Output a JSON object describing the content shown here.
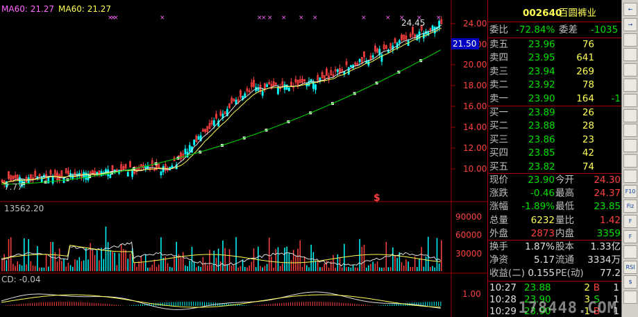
{
  "chart": {
    "ma_label": "MA60: 21.27",
    "ma_label2": "MA60: 21.27",
    "left_price": "7.77",
    "high_marker": "24.45",
    "price_box": "21.50",
    "price_ticks": [
      "24.00",
      "22.00",
      "20.00",
      "18.00",
      "16.00",
      "14.00",
      "12.00",
      "10.00"
    ],
    "vol_label": "13562.20",
    "vol_ticks": [
      "90000",
      "60000",
      "30000"
    ],
    "macd_label": "CD: -0.04",
    "macd_tick": "1.00",
    "dollar_marker": "$",
    "colors": {
      "up": "#ff4040",
      "down": "#00ffff",
      "ma": "#00c000",
      "grid": "#a00000"
    }
  },
  "quote": {
    "code": "002640",
    "name": "百圆裤业",
    "weibi_label": "委比",
    "weibi_value": "-72.84%",
    "weicha_label": "委差",
    "weicha_value": "-1035",
    "asks": [
      {
        "label": "卖五",
        "price": "23.96",
        "vol": "76",
        "chg": ""
      },
      {
        "label": "卖四",
        "price": "23.95",
        "vol": "641",
        "chg": ""
      },
      {
        "label": "卖三",
        "price": "23.94",
        "vol": "269",
        "chg": ""
      },
      {
        "label": "卖二",
        "price": "23.92",
        "vol": "78",
        "chg": ""
      },
      {
        "label": "卖一",
        "price": "23.90",
        "vol": "164",
        "chg": "-1"
      }
    ],
    "bids": [
      {
        "label": "买一",
        "price": "23.89",
        "vol": "26"
      },
      {
        "label": "买二",
        "price": "23.88",
        "vol": "28"
      },
      {
        "label": "买三",
        "price": "23.86",
        "vol": "23"
      },
      {
        "label": "买四",
        "price": "23.85",
        "vol": "42"
      },
      {
        "label": "买五",
        "price": "23.82",
        "vol": "74"
      }
    ],
    "stats": [
      {
        "l1": "现价",
        "v1": "23.90",
        "c1": "g",
        "l2": "今开",
        "v2": "24.30",
        "c2": "r"
      },
      {
        "l1": "涨跌",
        "v1": "-0.46",
        "c1": "g",
        "l2": "最高",
        "v2": "24.37",
        "c2": "r"
      },
      {
        "l1": "涨幅",
        "v1": "-1.89%",
        "c1": "g",
        "l2": "最低",
        "v2": "23.85",
        "c2": "g"
      },
      {
        "l1": "总量",
        "v1": "6232",
        "c1": "y",
        "l2": "量比",
        "v2": "1.42",
        "c2": "r"
      },
      {
        "l1": "外盘",
        "v1": "2873",
        "c1": "r",
        "l2": "内盘",
        "v2": "3359",
        "c2": "g"
      }
    ],
    "stats2": [
      {
        "l1": "换手",
        "v1": "1.87%",
        "l2": "股本",
        "v2": "1.33亿"
      },
      {
        "l1": "净资",
        "v1": "5.17",
        "l2": "流通",
        "v2": "3334万"
      },
      {
        "l1": "收益(二)",
        "v1": "0.155",
        "l2": "PE(动)",
        "v2": "77.2"
      }
    ],
    "ticks": [
      {
        "time": "10:27",
        "price": "23.88",
        "vol": "2",
        "side": "B",
        "n": "1"
      },
      {
        "time": "10:28",
        "price": "23.90",
        "vol": "3",
        "side": "S",
        "n": "1"
      },
      {
        "time": "10:29",
        "price": "23.90",
        "vol": "1",
        "side": "B",
        "n": "1"
      }
    ]
  },
  "toolbar": {
    "buttons": [
      "←",
      "→",
      "",
      "",
      "",
      "",
      "",
      "",
      "",
      "",
      "",
      "",
      "F10",
      "Fiz",
      "F",
      "F",
      "",
      "RSI",
      "$",
      ""
    ]
  },
  "watermark": "178448.COM"
}
